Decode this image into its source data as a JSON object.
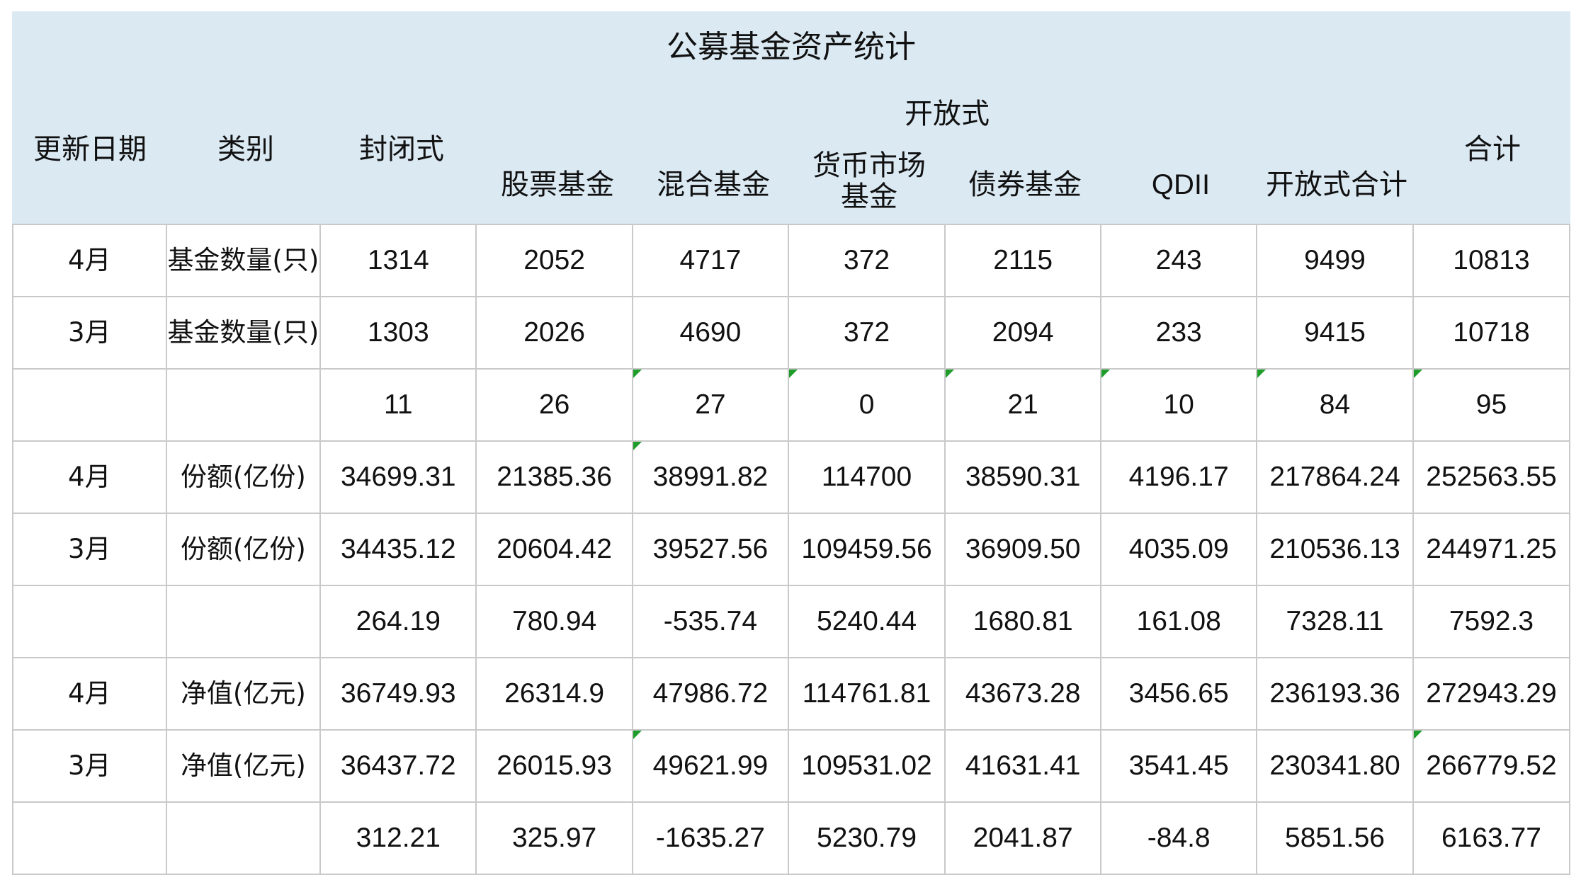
{
  "title": "公募基金资产统计",
  "headers": {
    "date": "更新日期",
    "category": "类别",
    "closed": "封闭式",
    "open_group": "开放式",
    "stock": "股票基金",
    "mixed": "混合基金",
    "money_market": "货币市场基金",
    "bond": "债券基金",
    "qdii": "QDII",
    "open_total": "开放式合计",
    "total": "合计"
  },
  "rows": [
    {
      "date": "4月",
      "category": "基金数量(只)",
      "values": [
        "1314",
        "2052",
        "4717",
        "372",
        "2115",
        "243",
        "9499",
        "10813"
      ]
    },
    {
      "date": "3月",
      "category": "基金数量(只)",
      "values": [
        "1303",
        "2026",
        "4690",
        "372",
        "2094",
        "233",
        "9415",
        "10718"
      ]
    },
    {
      "date": "",
      "category": "",
      "values": [
        "11",
        "26",
        "27",
        "0",
        "21",
        "10",
        "84",
        "95"
      ]
    },
    {
      "date": "4月",
      "category": "份额(亿份)",
      "values": [
        "34699.31",
        "21385.36",
        "38991.82",
        "114700",
        "38590.31",
        "4196.17",
        "217864.24",
        "252563.55"
      ]
    },
    {
      "date": "3月",
      "category": "份额(亿份)",
      "values": [
        "34435.12",
        "20604.42",
        "39527.56",
        "109459.56",
        "36909.50",
        "4035.09",
        "210536.13",
        "244971.25"
      ]
    },
    {
      "date": "",
      "category": "",
      "values": [
        "264.19",
        "780.94",
        "-535.74",
        "5240.44",
        "1680.81",
        "161.08",
        "7328.11",
        "7592.3"
      ]
    },
    {
      "date": "4月",
      "category": "净值(亿元)",
      "values": [
        "36749.93",
        "26314.9",
        "47986.72",
        "114761.81",
        "43673.28",
        "3456.65",
        "236193.36",
        "272943.29"
      ]
    },
    {
      "date": "3月",
      "category": "净值(亿元)",
      "values": [
        "36437.72",
        "26015.93",
        "49621.99",
        "109531.02",
        "41631.41",
        "3541.45",
        "230341.80",
        "266779.52"
      ]
    },
    {
      "date": "",
      "category": "",
      "values": [
        "312.21",
        "325.97",
        "-1635.27",
        "5230.79",
        "2041.87",
        "-84.8",
        "5851.56",
        "6163.77"
      ]
    }
  ],
  "colors": {
    "header_bg": "#dbe9f3",
    "grid": "#c9c9c9",
    "negative": "#e3231a",
    "comment_flag": "#1f9d2a"
  }
}
